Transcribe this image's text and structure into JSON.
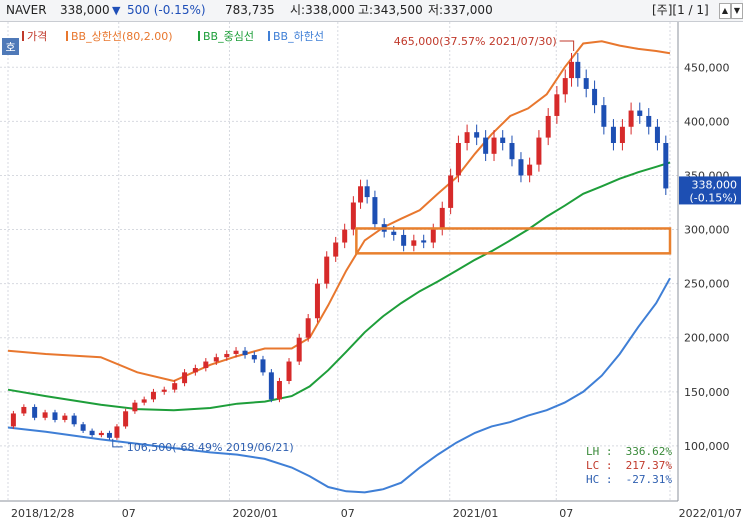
{
  "header": {
    "ticker": "NAVER",
    "price": "338,000",
    "change": "500 (-0.15%)",
    "volume": "783,735",
    "quote_current": "시:338,000",
    "quote_high": "고:343,500",
    "quote_low": "저:337,000",
    "page_indicator": "[주][1 / 1]",
    "down_icon": "▼"
  },
  "corner_label": "호",
  "legend": [
    {
      "label": "가격",
      "color": "#c0392b"
    },
    {
      "label": "BB_상한선(80,2.00)",
      "color": "#e8772e"
    },
    {
      "label": "BB_중심선",
      "color": "#1e9e3a"
    },
    {
      "label": "BB_하한선",
      "color": "#3f7fd6"
    }
  ],
  "price_box": {
    "line1": "338,000",
    "line2": "(-0.15%)"
  },
  "stats": [
    {
      "label": "LH :",
      "value": "336.62%",
      "color": "#3a8a3a"
    },
    {
      "label": "LC :",
      "value": "217.37%",
      "color": "#c0392b"
    },
    {
      "label": "HC :",
      "value": "-27.31%",
      "color": "#2e5fb0"
    }
  ],
  "chart_data": {
    "type": "candlestick",
    "x_range": [
      "2018-12-28",
      "2022-01-07"
    ],
    "ylim": [
      50000,
      490000
    ],
    "y_ticks": [
      "450,000",
      "400,000",
      "350,000",
      "300,000",
      "250,000",
      "200,000",
      "150,000",
      "100,000"
    ],
    "y_tick_values": [
      450000,
      400000,
      350000,
      300000,
      250000,
      200000,
      150000,
      100000
    ],
    "x_ticks": [
      {
        "label": "2018/12/28",
        "date": "2018-12-28"
      },
      {
        "label": "07",
        "date": "2019-07-01"
      },
      {
        "label": "2020/01",
        "date": "2020-01-02"
      },
      {
        "label": "07",
        "date": "2020-07-01"
      },
      {
        "label": "2021/01",
        "date": "2021-01-04"
      },
      {
        "label": "07",
        "date": "2021-07-01"
      },
      {
        "label": "2022/01/07",
        "date": "2022-01-07"
      }
    ],
    "series": [
      {
        "name": "가격",
        "key": "price",
        "points": [
          [
            "2018-12-28",
            118000
          ],
          [
            "2019-01-15",
            130000
          ],
          [
            "2019-02-01",
            136000
          ],
          [
            "2019-02-20",
            126000
          ],
          [
            "2019-03-08",
            131000
          ],
          [
            "2019-03-25",
            124000
          ],
          [
            "2019-04-10",
            128000
          ],
          [
            "2019-04-25",
            120000
          ],
          [
            "2019-05-10",
            114000
          ],
          [
            "2019-05-25",
            110000
          ],
          [
            "2019-06-10",
            112000
          ],
          [
            "2019-06-21",
            107500
          ],
          [
            "2019-07-05",
            118000
          ],
          [
            "2019-07-20",
            132000
          ],
          [
            "2019-08-05",
            140000
          ],
          [
            "2019-08-20",
            143000
          ],
          [
            "2019-09-05",
            150000
          ],
          [
            "2019-09-25",
            152000
          ],
          [
            "2019-10-10",
            158000
          ],
          [
            "2019-10-28",
            168000
          ],
          [
            "2019-11-15",
            172000
          ],
          [
            "2019-12-02",
            178000
          ],
          [
            "2019-12-20",
            182000
          ],
          [
            "2020-01-06",
            185000
          ],
          [
            "2020-01-20",
            188000
          ],
          [
            "2020-02-05",
            184000
          ],
          [
            "2020-02-20",
            180000
          ],
          [
            "2020-03-05",
            168000
          ],
          [
            "2020-03-19",
            143000
          ],
          [
            "2020-04-01",
            160000
          ],
          [
            "2020-04-20",
            178000
          ],
          [
            "2020-05-05",
            200000
          ],
          [
            "2020-05-20",
            218000
          ],
          [
            "2020-06-05",
            250000
          ],
          [
            "2020-06-20",
            275000
          ],
          [
            "2020-07-05",
            288000
          ],
          [
            "2020-07-20",
            300000
          ],
          [
            "2020-08-03",
            325000
          ],
          [
            "2020-08-13",
            340000
          ],
          [
            "2020-08-25",
            330000
          ],
          [
            "2020-09-08",
            305000
          ],
          [
            "2020-09-25",
            298000
          ],
          [
            "2020-10-10",
            295000
          ],
          [
            "2020-10-28",
            285000
          ],
          [
            "2020-11-13",
            290000
          ],
          [
            "2020-11-30",
            288000
          ],
          [
            "2020-12-15",
            300000
          ],
          [
            "2020-12-30",
            320000
          ],
          [
            "2021-01-12",
            350000
          ],
          [
            "2021-01-25",
            380000
          ],
          [
            "2021-02-10",
            390000
          ],
          [
            "2021-02-26",
            385000
          ],
          [
            "2021-03-12",
            370000
          ],
          [
            "2021-03-26",
            385000
          ],
          [
            "2021-04-10",
            380000
          ],
          [
            "2021-04-26",
            365000
          ],
          [
            "2021-05-10",
            350000
          ],
          [
            "2021-05-25",
            360000
          ],
          [
            "2021-06-10",
            385000
          ],
          [
            "2021-06-25",
            405000
          ],
          [
            "2021-07-09",
            425000
          ],
          [
            "2021-07-23",
            440000
          ],
          [
            "2021-07-30",
            455000
          ],
          [
            "2021-08-13",
            440000
          ],
          [
            "2021-08-27",
            430000
          ],
          [
            "2021-09-10",
            415000
          ],
          [
            "2021-09-27",
            395000
          ],
          [
            "2021-10-12",
            380000
          ],
          [
            "2021-10-27",
            395000
          ],
          [
            "2021-11-10",
            410000
          ],
          [
            "2021-11-25",
            405000
          ],
          [
            "2021-12-10",
            395000
          ],
          [
            "2021-12-24",
            380000
          ],
          [
            "2022-01-07",
            338000
          ]
        ]
      },
      {
        "name": "BB_상한선(80,2.00)",
        "key": "upper",
        "points": [
          [
            "2018-12-28",
            188000
          ],
          [
            "2019-03-01",
            185000
          ],
          [
            "2019-06-01",
            182000
          ],
          [
            "2019-08-01",
            168000
          ],
          [
            "2019-10-01",
            160000
          ],
          [
            "2019-12-01",
            175000
          ],
          [
            "2020-01-15",
            183000
          ],
          [
            "2020-03-01",
            190000
          ],
          [
            "2020-04-15",
            190000
          ],
          [
            "2020-05-15",
            200000
          ],
          [
            "2020-06-15",
            230000
          ],
          [
            "2020-07-15",
            262000
          ],
          [
            "2020-08-15",
            290000
          ],
          [
            "2020-09-15",
            302000
          ],
          [
            "2020-10-15",
            310000
          ],
          [
            "2020-11-15",
            318000
          ],
          [
            "2020-12-15",
            333000
          ],
          [
            "2021-01-15",
            348000
          ],
          [
            "2021-02-15",
            370000
          ],
          [
            "2021-03-15",
            388000
          ],
          [
            "2021-04-15",
            405000
          ],
          [
            "2021-05-15",
            412000
          ],
          [
            "2021-06-15",
            425000
          ],
          [
            "2021-07-15",
            450000
          ],
          [
            "2021-08-15",
            472000
          ],
          [
            "2021-09-15",
            474000
          ],
          [
            "2021-10-15",
            470000
          ],
          [
            "2021-11-15",
            467000
          ],
          [
            "2021-12-15",
            465000
          ],
          [
            "2022-01-07",
            463000
          ]
        ]
      },
      {
        "name": "BB_중심선",
        "key": "middle",
        "points": [
          [
            "2018-12-28",
            152000
          ],
          [
            "2019-03-01",
            146000
          ],
          [
            "2019-06-01",
            138000
          ],
          [
            "2019-08-01",
            134000
          ],
          [
            "2019-10-01",
            133000
          ],
          [
            "2019-12-01",
            135000
          ],
          [
            "2020-01-15",
            139000
          ],
          [
            "2020-03-01",
            141000
          ],
          [
            "2020-04-15",
            146000
          ],
          [
            "2020-05-15",
            155000
          ],
          [
            "2020-06-15",
            170000
          ],
          [
            "2020-07-15",
            187000
          ],
          [
            "2020-08-15",
            205000
          ],
          [
            "2020-09-15",
            220000
          ],
          [
            "2020-10-15",
            232000
          ],
          [
            "2020-11-15",
            243000
          ],
          [
            "2020-12-15",
            252000
          ],
          [
            "2021-01-15",
            262000
          ],
          [
            "2021-02-15",
            272000
          ],
          [
            "2021-03-15",
            280000
          ],
          [
            "2021-04-15",
            290000
          ],
          [
            "2021-05-15",
            300000
          ],
          [
            "2021-06-15",
            312000
          ],
          [
            "2021-07-15",
            322000
          ],
          [
            "2021-08-15",
            333000
          ],
          [
            "2021-09-15",
            340000
          ],
          [
            "2021-10-15",
            347000
          ],
          [
            "2021-11-15",
            353000
          ],
          [
            "2021-12-15",
            358000
          ],
          [
            "2022-01-07",
            362000
          ]
        ]
      },
      {
        "name": "BB_하한선",
        "key": "lower",
        "points": [
          [
            "2018-12-28",
            117000
          ],
          [
            "2019-03-01",
            113000
          ],
          [
            "2019-06-01",
            106000
          ],
          [
            "2019-08-01",
            102000
          ],
          [
            "2019-10-01",
            98000
          ],
          [
            "2019-12-01",
            94000
          ],
          [
            "2020-01-15",
            92000
          ],
          [
            "2020-03-01",
            88000
          ],
          [
            "2020-04-15",
            80000
          ],
          [
            "2020-05-15",
            72000
          ],
          [
            "2020-06-15",
            62000
          ],
          [
            "2020-07-15",
            58000
          ],
          [
            "2020-08-15",
            57000
          ],
          [
            "2020-09-15",
            60000
          ],
          [
            "2020-10-15",
            66000
          ],
          [
            "2020-11-15",
            80000
          ],
          [
            "2020-12-15",
            92000
          ],
          [
            "2021-01-15",
            103000
          ],
          [
            "2021-02-15",
            112000
          ],
          [
            "2021-03-15",
            118000
          ],
          [
            "2021-04-15",
            122000
          ],
          [
            "2021-05-15",
            128000
          ],
          [
            "2021-06-15",
            133000
          ],
          [
            "2021-07-15",
            140000
          ],
          [
            "2021-08-15",
            150000
          ],
          [
            "2021-09-15",
            165000
          ],
          [
            "2021-10-15",
            185000
          ],
          [
            "2021-11-15",
            210000
          ],
          [
            "2021-12-15",
            232000
          ],
          [
            "2022-01-07",
            255000
          ]
        ]
      }
    ],
    "annotations": [
      {
        "kind": "high",
        "date": "2021-07-30",
        "value": 465000,
        "text": "465,000(37.57% 2021/07/30)"
      },
      {
        "kind": "low",
        "date": "2019-06-21",
        "value": 106500,
        "text": "106,500(-68.49% 2019/06/21)"
      }
    ],
    "zone": {
      "date_from": "2020-08-01",
      "date_to": "2022-01-07",
      "y_from": 278000,
      "y_to": 301000,
      "color": "#e8802e"
    },
    "grid": true,
    "legend_position": "top-left",
    "colors": {
      "up": "#d62a2a",
      "down": "#1d4fb3",
      "upper": "#e8772e",
      "middle": "#1e9e3a",
      "lower": "#3f7fd6"
    }
  }
}
